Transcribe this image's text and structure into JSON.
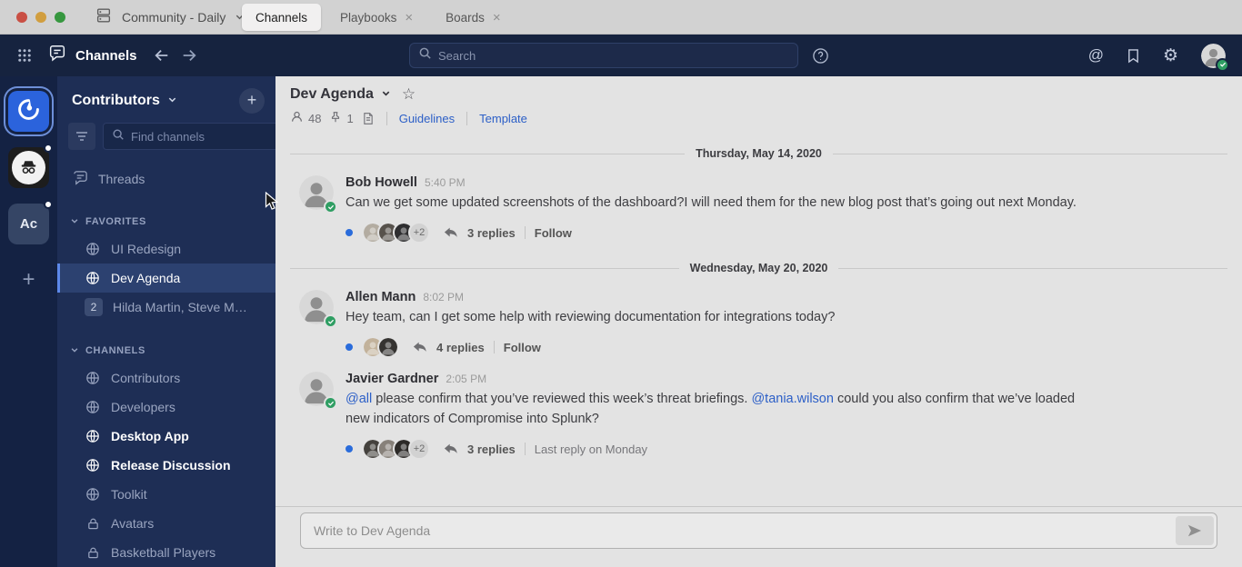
{
  "titlebar": {
    "server_menu": {
      "label": "Community - Daily"
    },
    "tabs": [
      {
        "label": "Channels",
        "active": true,
        "closable": false
      },
      {
        "label": "Playbooks",
        "active": false,
        "closable": true
      },
      {
        "label": "Boards",
        "active": false,
        "closable": true
      }
    ]
  },
  "global_header": {
    "product_name": "Channels",
    "search": {
      "placeholder": "Search"
    }
  },
  "team_sidebar": {
    "teams": [
      {
        "name": "mattermost",
        "icon": "mattermost-logo",
        "selected": true,
        "notification_dot": false
      },
      {
        "name": "incognito",
        "icon": "incognito-avatar",
        "selected": false,
        "notification_dot": true
      },
      {
        "name": "Ac",
        "initials": "Ac",
        "selected": false,
        "notification_dot": true
      }
    ]
  },
  "channel_sidebar": {
    "team_name": "Contributors",
    "find_channels_placeholder": "Find channels",
    "threads_label": "Threads",
    "sections": [
      {
        "title": "FAVORITES",
        "items": [
          {
            "label": "UI Redesign",
            "icon": "globe",
            "selected": false,
            "unread": false
          },
          {
            "label": "Dev Agenda",
            "icon": "globe",
            "selected": true,
            "unread": false
          },
          {
            "label": "Hilda Martin, Steve M…",
            "icon": "badge",
            "badge": "2",
            "selected": false,
            "unread": false
          }
        ]
      },
      {
        "title": "CHANNELS",
        "items": [
          {
            "label": "Contributors",
            "icon": "globe",
            "selected": false,
            "unread": false
          },
          {
            "label": "Developers",
            "icon": "globe",
            "selected": false,
            "unread": false
          },
          {
            "label": "Desktop App",
            "icon": "globe",
            "selected": false,
            "unread": true
          },
          {
            "label": "Release Discussion",
            "icon": "globe",
            "selected": false,
            "unread": true
          },
          {
            "label": "Toolkit",
            "icon": "globe",
            "selected": false,
            "unread": false
          },
          {
            "label": "Avatars",
            "icon": "lock",
            "selected": false,
            "unread": false
          },
          {
            "label": "Basketball Players",
            "icon": "lock",
            "selected": false,
            "unread": false
          }
        ]
      }
    ]
  },
  "channel_header": {
    "title": "Dev Agenda",
    "member_count": "48",
    "pinned_count": "1",
    "links": [
      "Guidelines",
      "Template"
    ]
  },
  "messages": [
    {
      "type": "date",
      "label": "Thursday, May 14, 2020"
    },
    {
      "type": "post",
      "author": "Bob Howell",
      "time": "5:40 PM",
      "parts": [
        {
          "text": "Can we get some updated screenshots of the dashboard?I will need them for the new blog post that’s going out next Monday.",
          "mention": false
        }
      ],
      "thread": {
        "participant_avatars": 3,
        "overflow": "+2",
        "replies": "3 replies",
        "meta": "Follow"
      }
    },
    {
      "type": "date",
      "label": "Wednesday, May 20, 2020"
    },
    {
      "type": "post",
      "author": "Allen Mann",
      "time": "8:02 PM",
      "parts": [
        {
          "text": "Hey team, can I get some help with reviewing documentation for integrations today?",
          "mention": false
        }
      ],
      "thread": {
        "participant_avatars": 2,
        "overflow": null,
        "replies": "4 replies",
        "meta": "Follow"
      }
    },
    {
      "type": "post",
      "author": "Javier Gardner",
      "time": "2:05 PM",
      "parts": [
        {
          "text": "@all",
          "mention": true
        },
        {
          "text": " please confirm that you’ve reviewed this week’s threat briefings. ",
          "mention": false
        },
        {
          "text": "@tania.wilson",
          "mention": true
        },
        {
          "text": " could you also confirm that we’ve loaded new indicators of Compromise into Splunk?",
          "mention": false
        }
      ],
      "thread": {
        "participant_avatars": 3,
        "overflow": "+2",
        "replies": "3 replies",
        "meta": "Last reply on Monday"
      }
    }
  ],
  "composer": {
    "placeholder": "Write to Dev Agenda"
  },
  "colors": {
    "header_bg": "#16233f",
    "sidebar_bg": "#1e2e55",
    "team_sidebar_bg": "#142243",
    "main_bg": "#e3e3e3",
    "accent_blue": "#2a6cdb",
    "link_blue": "#2c5fc7",
    "selected_border": "#5d89ea",
    "online_green": "#2f9e63",
    "traffic_red": "#c94f44",
    "traffic_yellow": "#d19e3f",
    "traffic_green": "#36973f"
  }
}
